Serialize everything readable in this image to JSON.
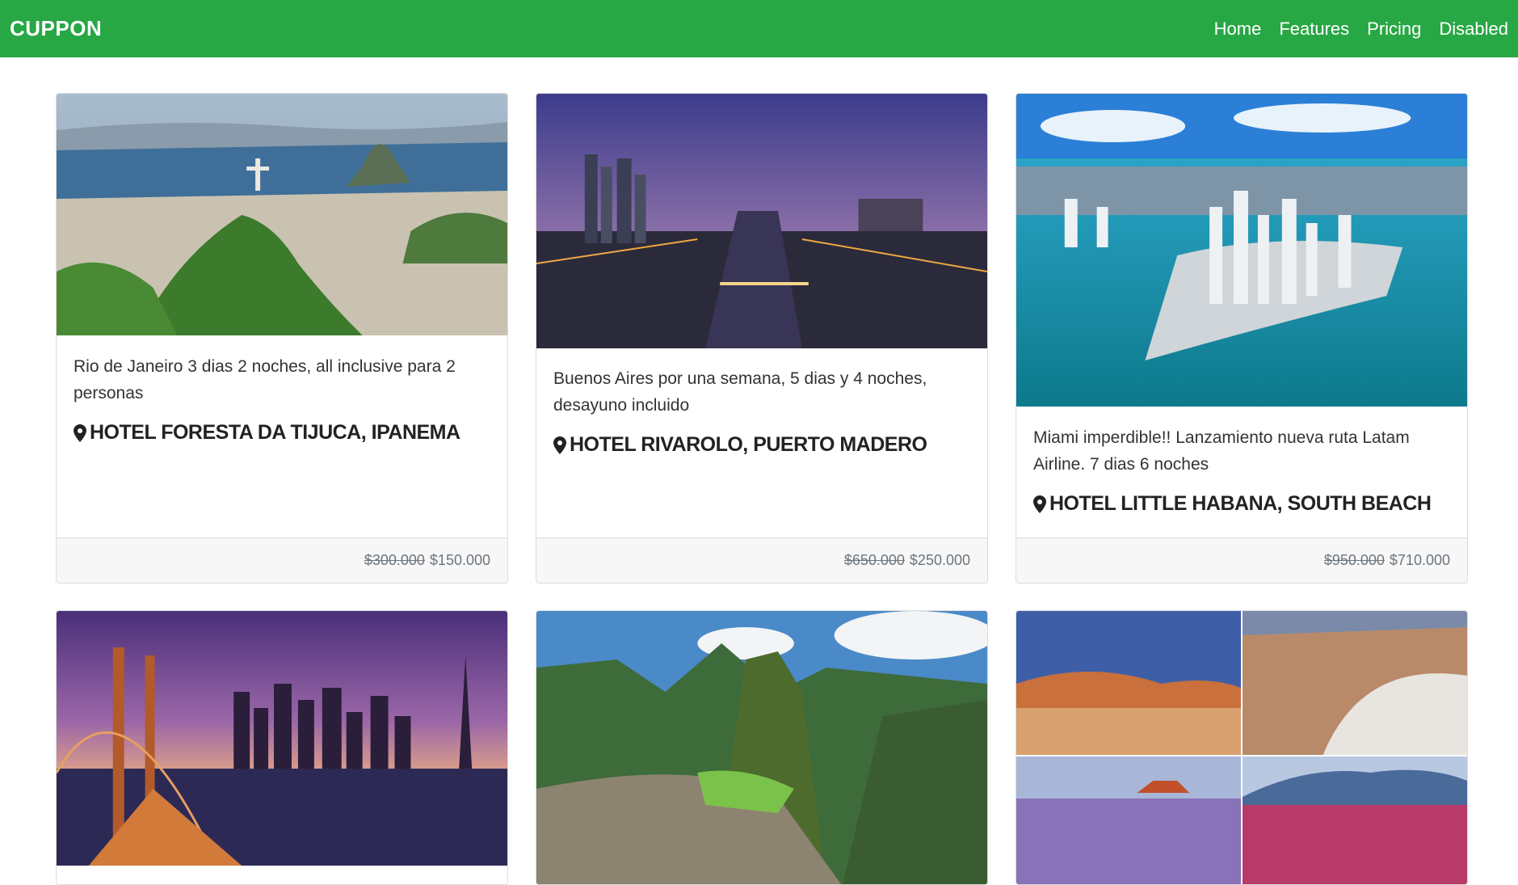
{
  "navbar": {
    "brand": "CUPPON",
    "links": [
      "Home",
      "Features",
      "Pricing",
      "Disabled"
    ]
  },
  "cards": [
    {
      "image": "rio-de-janeiro-aerial-photo",
      "description": "Rio de Janeiro 3 dias 2 noches, all inclusive para 2 personas",
      "hotel": "HOTEL FORESTA DA TIJUCA, IPANEMA",
      "old_price": "$300.000",
      "price": "$150.000"
    },
    {
      "image": "buenos-aires-puerto-madero-night-photo",
      "description": "Buenos Aires por una semana, 5 dias y 4 noches, desayuno incluido",
      "hotel": "HOTEL RIVAROLO, PUERTO MADERO",
      "old_price": "$650.000",
      "price": "$250.000"
    },
    {
      "image": "miami-aerial-photo",
      "description": "Miami imperdible!! Lanzamiento nueva ruta Latam Airline. 7 dias 6 noches",
      "hotel": "HOTEL LITTLE HABANA, SOUTH BEACH",
      "old_price": "$950.000",
      "price": "$710.000"
    },
    {
      "image": "san-francisco-bay-bridge-night-photo"
    },
    {
      "image": "machu-picchu-photo"
    },
    {
      "image": "atacama-desert-collage-photo"
    }
  ],
  "colors": {
    "navbar": "#28a745",
    "footer_bg": "#f7f7f7",
    "muted_text": "#6c757d"
  },
  "icons": {
    "location": "map-marker-icon"
  }
}
